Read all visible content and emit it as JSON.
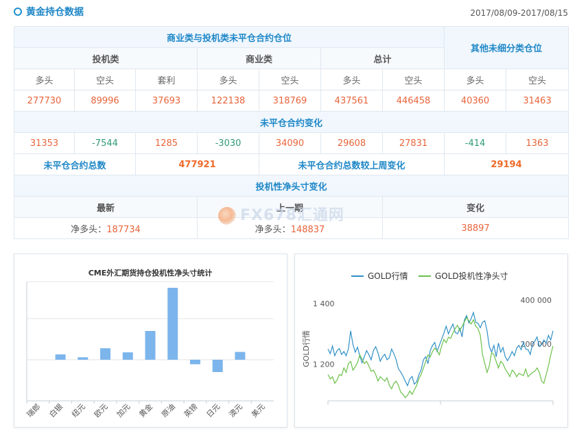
{
  "header": {
    "title": "黄金持仓数据",
    "date_range": "2017/08/09-2017/08/15"
  },
  "table": {
    "commercial_section": "商业类与投机类未平仓合约仓位",
    "other_section": "其他未细分类仓位",
    "groups": {
      "speculative": "投机类",
      "commercial": "商业类",
      "total": "总计"
    },
    "subheaders": [
      "多头",
      "空头",
      "套利",
      "多头",
      "空头",
      "多头",
      "空头",
      "多头",
      "空头"
    ],
    "values": [
      "277730",
      "89996",
      "37693",
      "122138",
      "318769",
      "437561",
      "446458",
      "40360",
      "31463"
    ],
    "change_section": "未平仓合约变化",
    "changes": [
      "31353",
      "-7544",
      "1285",
      "-3030",
      "34090",
      "29608",
      "27831",
      "-414",
      "1363"
    ],
    "total_oi_label": "未平仓合约总数",
    "total_oi_value": "477921",
    "total_oi_change_label": "未平仓合约总数较上周变化",
    "total_oi_change_value": "29194",
    "net_section": "投机性净头寸变化",
    "net_headers": {
      "latest": "最新",
      "previous": "上一期",
      "change": "变化"
    },
    "net_latest_label": "净多头：",
    "net_latest_value": "187734",
    "net_prev_label": "净多头：",
    "net_prev_value": "148837",
    "net_change_value": "38897"
  },
  "watermark": {
    "text": "FX678汇通网"
  },
  "chart_data": [
    {
      "type": "bar",
      "title": "CME外汇期货持仓投机性净头寸统计",
      "categories": [
        "瑞郎",
        "白银",
        "纽元",
        "欧元",
        "加元",
        "黄金",
        "原油",
        "英镑",
        "日元",
        "澳元",
        "美元"
      ],
      "values": [
        0,
        13000,
        6000,
        28000,
        18000,
        70000,
        175000,
        -11000,
        -30000,
        19000,
        0
      ],
      "ylim": [
        -100000,
        190000
      ],
      "grid": true,
      "bar_color": "#7cb5ec"
    },
    {
      "type": "line",
      "legend": [
        "GOLD行情",
        "GOLD投机性净头寸"
      ],
      "legend_position": "top",
      "ylabel": "GOLD行情",
      "left_ticks": [
        "1 400",
        "1 200"
      ],
      "right_ticks": [
        "400 000",
        "200 000"
      ],
      "ylim_left": [
        1080,
        1440
      ],
      "ylim_right": [
        -60000,
        440000
      ],
      "series": [
        {
          "name": "GOLD行情",
          "color": "#2f8fc6",
          "values": [
            1250,
            1235,
            1260,
            1228,
            1245,
            1252,
            1232,
            1242,
            1228,
            1250,
            1310,
            1265,
            1240,
            1256,
            1228,
            1205,
            1225,
            1245,
            1232,
            1215,
            1245,
            1258,
            1238,
            1210,
            1225,
            1233,
            1215,
            1222,
            1250,
            1235,
            1215,
            1185,
            1175,
            1162,
            1145,
            1130,
            1152,
            1160,
            1135,
            1142,
            1165,
            1182,
            1215,
            1225,
            1202,
            1245,
            1262,
            1272,
            1242,
            1262,
            1282,
            1302,
            1325,
            1300,
            1318,
            1332,
            1305,
            1300,
            1318,
            1290,
            1345,
            1360,
            1336,
            1350,
            1370,
            1338,
            1335,
            1320,
            1338,
            1343,
            1310,
            1258,
            1240,
            1262,
            1225,
            1270,
            1240,
            1255,
            1225,
            1212,
            1225,
            1242,
            1228,
            1253,
            1262,
            1248,
            1272,
            1250,
            1248,
            1232,
            1268,
            1275,
            1290,
            1258,
            1265,
            1280,
            1270,
            1295,
            1280,
            1310
          ]
        },
        {
          "name": "GOLD投机性净头寸",
          "color": "#6cc04a",
          "values": [
            60000,
            40000,
            50000,
            20000,
            35000,
            60000,
            55000,
            90000,
            70000,
            110000,
            120000,
            80000,
            95000,
            115000,
            150000,
            130000,
            110000,
            120000,
            100000,
            75000,
            80000,
            60000,
            30000,
            50000,
            40000,
            30000,
            45000,
            10000,
            -5000,
            20000,
            30000,
            10000,
            -20000,
            -30000,
            -45000,
            -35000,
            -15000,
            -30000,
            -10000,
            10000,
            40000,
            60000,
            90000,
            120000,
            150000,
            140000,
            165000,
            180000,
            170000,
            150000,
            190000,
            220000,
            205000,
            230000,
            225000,
            250000,
            270000,
            285000,
            260000,
            280000,
            300000,
            320000,
            305000,
            290000,
            310000,
            280000,
            270000,
            240000,
            150000,
            110000,
            70000,
            100000,
            160000,
            150000,
            120000,
            90000,
            120000,
            110000,
            85000,
            70000,
            50000,
            80000,
            70000,
            50000,
            65000,
            60000,
            55000,
            85000,
            50000,
            60000,
            70000,
            75000,
            90000,
            70000,
            30000,
            20000,
            60000,
            100000,
            150000,
            190000
          ]
        }
      ]
    }
  ]
}
